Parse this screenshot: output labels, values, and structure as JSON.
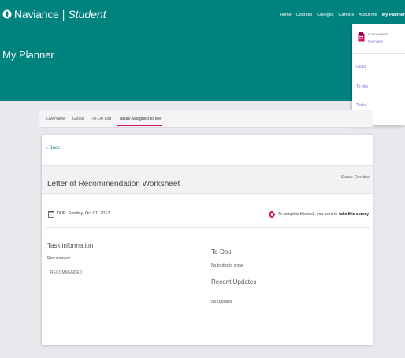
{
  "header": {
    "brand_name": "Naviance",
    "brand_separator": "|",
    "brand_sub": "Student",
    "page_title": "My Planner",
    "bg_color": "#00827f",
    "icons": {
      "logo": "naviance-leaf-logo-icon"
    }
  },
  "topnav": {
    "items": [
      "Home",
      "Courses",
      "Colleges",
      "Careers",
      "About Me",
      "My Planner"
    ]
  },
  "dropdown": {
    "section_label": "MY PLANNER",
    "overview": "Overview",
    "items": [
      "Goals",
      "To-dos",
      "Tasks"
    ],
    "icons": {
      "section": "planner-icon"
    }
  },
  "tabs": {
    "items": [
      "Overview",
      "Goals",
      "To-Do List",
      "Tasks Assigned to Me"
    ],
    "active": "Tasks Assigned to Me",
    "accent_color": "#c81266"
  },
  "card": {
    "back_label": "Back",
    "task_title": "Letter of Recommendation Worksheet",
    "status": "Status: Overdue",
    "due": "DUE: Sunday, Oct 01, 2017",
    "survey_text": "To complete this task, you need to",
    "survey_link": "take this survey",
    "task_info_heading": "Task information",
    "requirement_label": "Requirement:",
    "requirement_value": "RECOMMENDED",
    "todos_heading": "To-Dos",
    "todos_empty": "No to-dos to show",
    "updates_heading": "Recent Updates",
    "updates_empty": "No Updates",
    "icons": {
      "back": "chevron-left-icon",
      "due": "calendar-icon",
      "survey": "survey-diamond-icon"
    }
  }
}
